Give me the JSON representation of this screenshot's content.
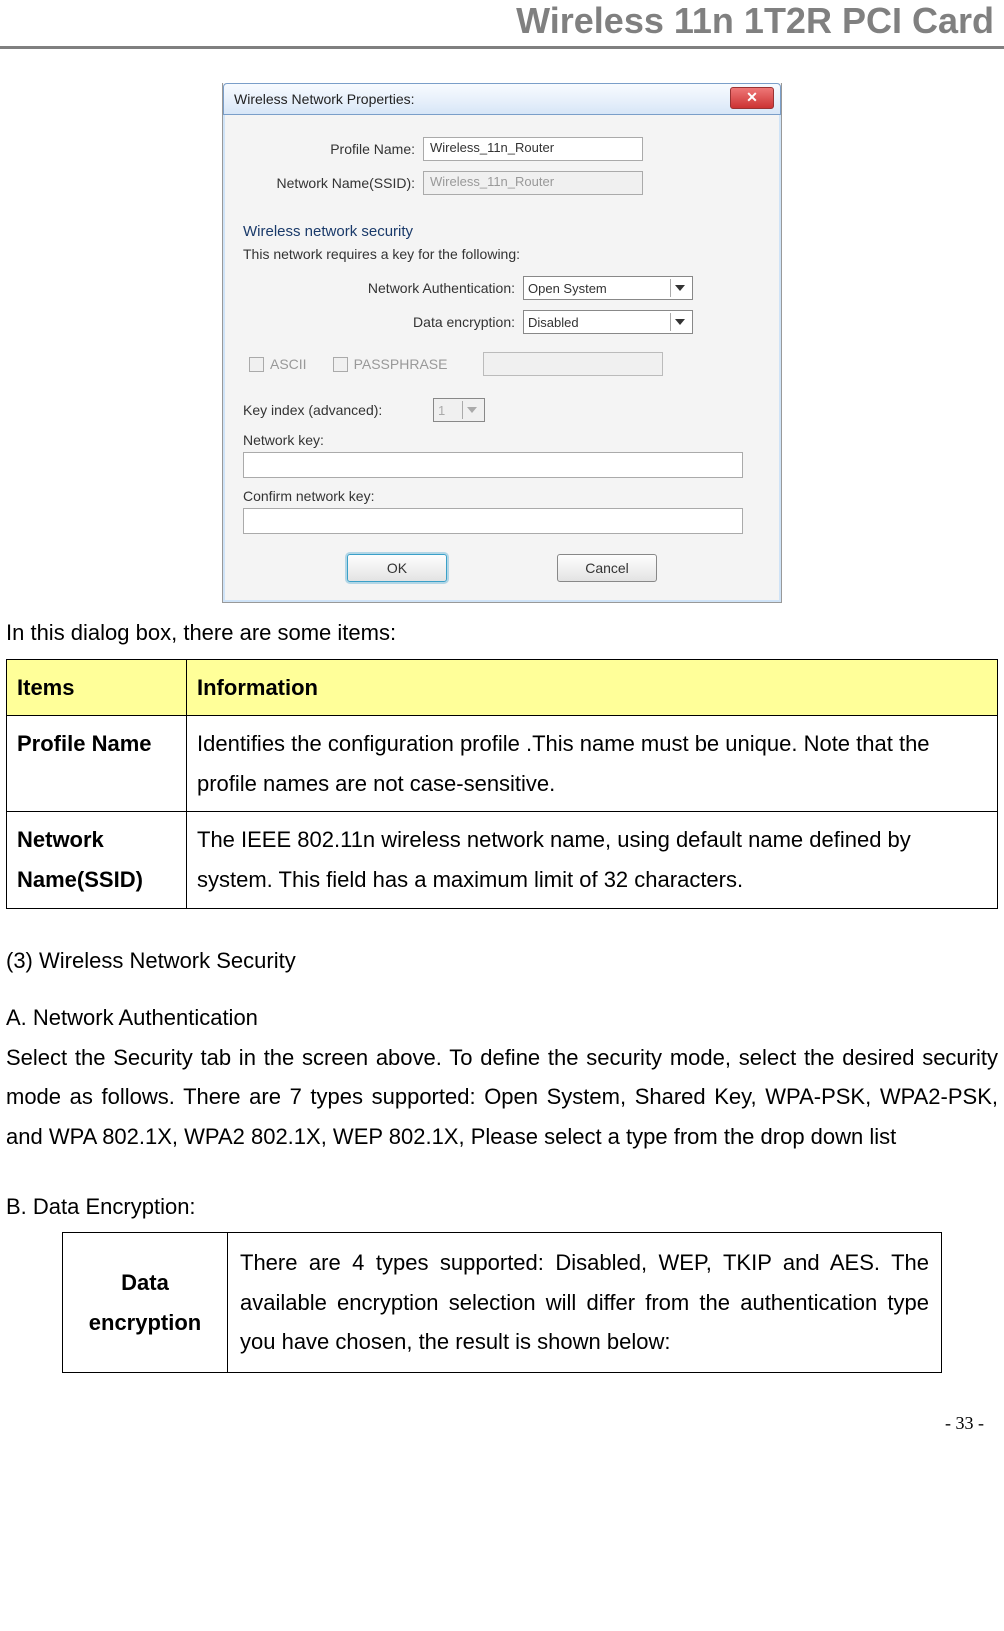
{
  "header": {
    "title": "Wireless 11n 1T2R PCI Card"
  },
  "dialog": {
    "title": "Wireless Network Properties:",
    "profile_name_label": "Profile Name:",
    "profile_name_value": "Wireless_11n_Router",
    "ssid_label": "Network Name(SSID):",
    "ssid_value": "Wireless_11n_Router",
    "group_title": "Wireless network security",
    "group_desc": "This network requires a key for the following:",
    "auth_label": "Network Authentication:",
    "auth_value": "Open System",
    "enc_label": "Data encryption:",
    "enc_value": "Disabled",
    "ascii_label": "ASCII",
    "passphrase_label": "PASSPHRASE",
    "keyindex_label": "Key index (advanced):",
    "keyindex_value": "1",
    "netkey_label": "Network key:",
    "confirm_label": "Confirm network key:",
    "ok_label": "OK",
    "cancel_label": "Cancel"
  },
  "intro_line": "In this dialog box, there are some items:",
  "table1": {
    "items_header": "Items",
    "info_header": "Information",
    "rows": [
      {
        "item": "Profile Name",
        "info": "Identifies the configuration profile .This name must be unique. Note that the profile names are not case-sensitive."
      },
      {
        "item": "Network Name(SSID)",
        "info": "The IEEE 802.11n wireless network name, using default name defined by system. This field has a maximum limit of 32 characters."
      }
    ]
  },
  "sec3_title": "(3) Wireless Network Security",
  "secA_title": "A. Network Authentication",
  "secA_body": "Select the Security tab in the screen above. To define the security mode, select the desired security mode as follows. There are 7 types supported: Open System, Shared Key, WPA-PSK, WPA2-PSK, and WPA 802.1X, WPA2 802.1X, WEP 802.1X, Please select a type from the drop down list",
  "secB_title": "B. Data Encryption:",
  "table2": {
    "item": "Data encryption",
    "info": "There are 4 types supported: Disabled, WEP, TKIP and AES. The available encryption selection will differ from the authentication type you have chosen, the result is shown below:"
  },
  "page_number": "- 33 -"
}
